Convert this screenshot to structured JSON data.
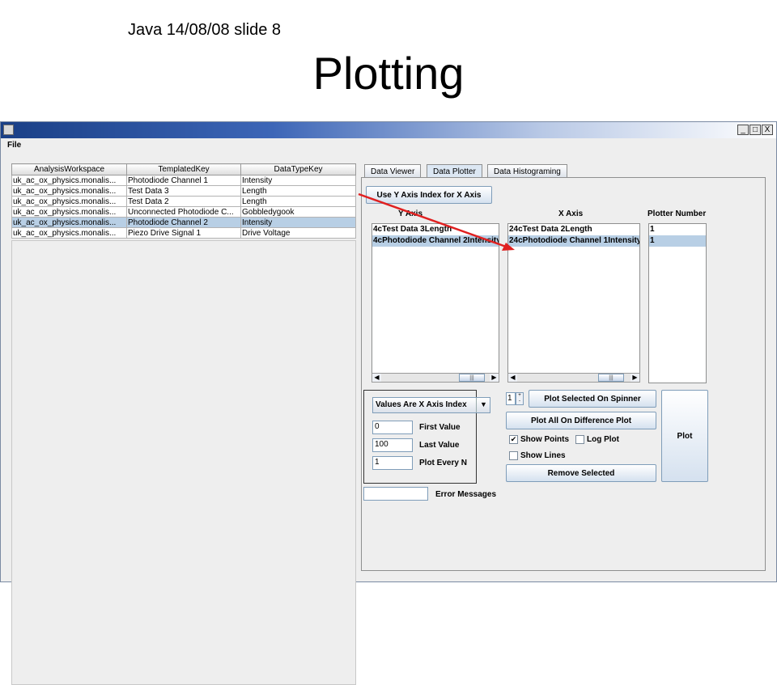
{
  "slide": {
    "subtitle": "Java 14/08/08 slide 8",
    "title": "Plotting"
  },
  "window": {
    "min_glyph": "_",
    "max_glyph": "□",
    "close_glyph": "X"
  },
  "menu": {
    "file": "File"
  },
  "table": {
    "headers": [
      "AnalysisWorkspace",
      "TemplatedKey",
      "DataTypeKey"
    ],
    "rows": [
      [
        "uk_ac_ox_physics.monalis...",
        "Photodiode Channel 1",
        "Intensity"
      ],
      [
        "uk_ac_ox_physics.monalis...",
        "Test Data 3",
        "Length"
      ],
      [
        "uk_ac_ox_physics.monalis...",
        "Test Data 2",
        "Length"
      ],
      [
        "uk_ac_ox_physics.monalis...",
        "Unconnected Photodiode C...",
        "Gobbledygook"
      ],
      [
        "uk_ac_ox_physics.monalis...",
        "Photodiode Channel 2",
        "Intensity"
      ],
      [
        "uk_ac_ox_physics.monalis...",
        "Piezo Drive Signal 1",
        "Drive Voltage"
      ]
    ],
    "selected_row": 4
  },
  "tabs": [
    "Data Viewer",
    "Data Plotter",
    "Data Histograming"
  ],
  "active_tab": "Data Plotter",
  "plotter": {
    "use_y_axis_button": "Use Y Axis Index for X Axis",
    "y_axis_label": "Y Axis",
    "x_axis_label": "X Axis",
    "plotter_number_label": "Plotter Number",
    "y_axis_items": [
      "4cTest Data 3Length",
      "4cPhotodiode Channel 2Intensity"
    ],
    "x_axis_items": [
      "24cTest Data 2Length",
      "24cPhotodiode Channel 1Intensity"
    ],
    "plotter_numbers": [
      "1",
      "1"
    ],
    "index_combo": "Values Are X Axis Index",
    "first_value": "0",
    "first_value_label": "First Value",
    "last_value": "100",
    "last_value_label": "Last Value",
    "plot_every": "1",
    "plot_every_label": "Plot Every N",
    "spinner_value": "1",
    "plot_selected_button": "Plot Selected On Spinner",
    "plot_all_button": "Plot All On Difference Plot",
    "show_points_label": "Show Points",
    "show_points_checked": true,
    "log_plot_label": "Log Plot",
    "log_plot_checked": false,
    "show_lines_label": "Show Lines",
    "show_lines_checked": false,
    "remove_selected_button": "Remove Selected",
    "plot_button": "Plot",
    "error_messages_value": "",
    "error_messages_label": "Error Messages"
  },
  "colors": {
    "selection": "#b8cfe5",
    "annotation_arrow": "#e02020",
    "title_bar": "#1a3f86"
  }
}
